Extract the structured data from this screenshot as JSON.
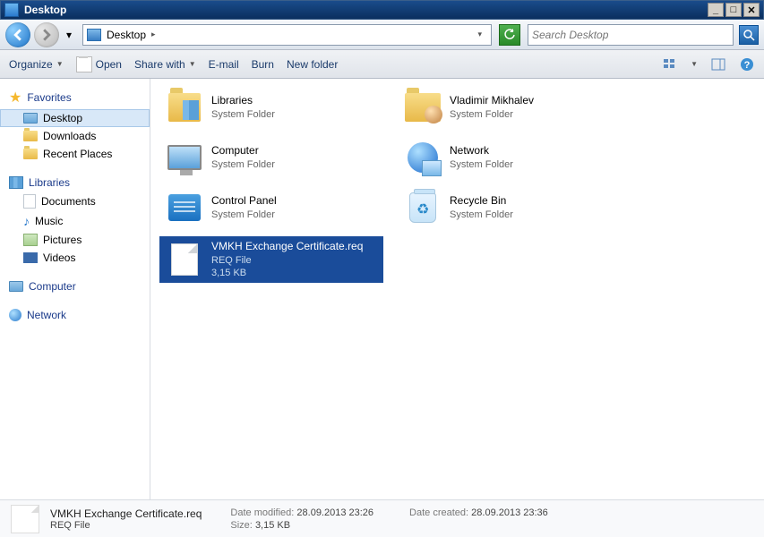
{
  "window": {
    "title": "Desktop"
  },
  "nav": {
    "address": "Desktop",
    "search_placeholder": "Search Desktop"
  },
  "toolbar": {
    "organize": "Organize",
    "open": "Open",
    "share": "Share with",
    "email": "E-mail",
    "burn": "Burn",
    "newfolder": "New folder"
  },
  "sidebar": {
    "favorites": {
      "label": "Favorites",
      "items": [
        {
          "label": "Desktop",
          "icon": "monitor",
          "selected": true
        },
        {
          "label": "Downloads",
          "icon": "folder"
        },
        {
          "label": "Recent Places",
          "icon": "folder"
        }
      ]
    },
    "libraries": {
      "label": "Libraries",
      "items": [
        {
          "label": "Documents",
          "icon": "doc"
        },
        {
          "label": "Music",
          "icon": "music"
        },
        {
          "label": "Pictures",
          "icon": "pic"
        },
        {
          "label": "Videos",
          "icon": "video"
        }
      ]
    },
    "computer": {
      "label": "Computer"
    },
    "network": {
      "label": "Network"
    }
  },
  "items": [
    {
      "name": "Libraries",
      "sub1": "System Folder",
      "icon": "lib"
    },
    {
      "name": "Vladimir Mikhalev",
      "sub1": "System Folder",
      "icon": "user"
    },
    {
      "name": "Computer",
      "sub1": "System Folder",
      "icon": "monitor"
    },
    {
      "name": "Network",
      "sub1": "System Folder",
      "icon": "net"
    },
    {
      "name": "Control Panel",
      "sub1": "System Folder",
      "icon": "cpanel"
    },
    {
      "name": "Recycle Bin",
      "sub1": "System Folder",
      "icon": "bin"
    },
    {
      "name": "VMKH Exchange Certificate.req",
      "sub1": "REQ File",
      "sub2": "3,15 KB",
      "icon": "file",
      "selected": true
    }
  ],
  "details": {
    "name": "VMKH Exchange Certificate.req",
    "type": "REQ File",
    "modified_label": "Date modified:",
    "modified": "28.09.2013 23:26",
    "size_label": "Size:",
    "size": "3,15 KB",
    "created_label": "Date created:",
    "created": "28.09.2013 23:36"
  }
}
